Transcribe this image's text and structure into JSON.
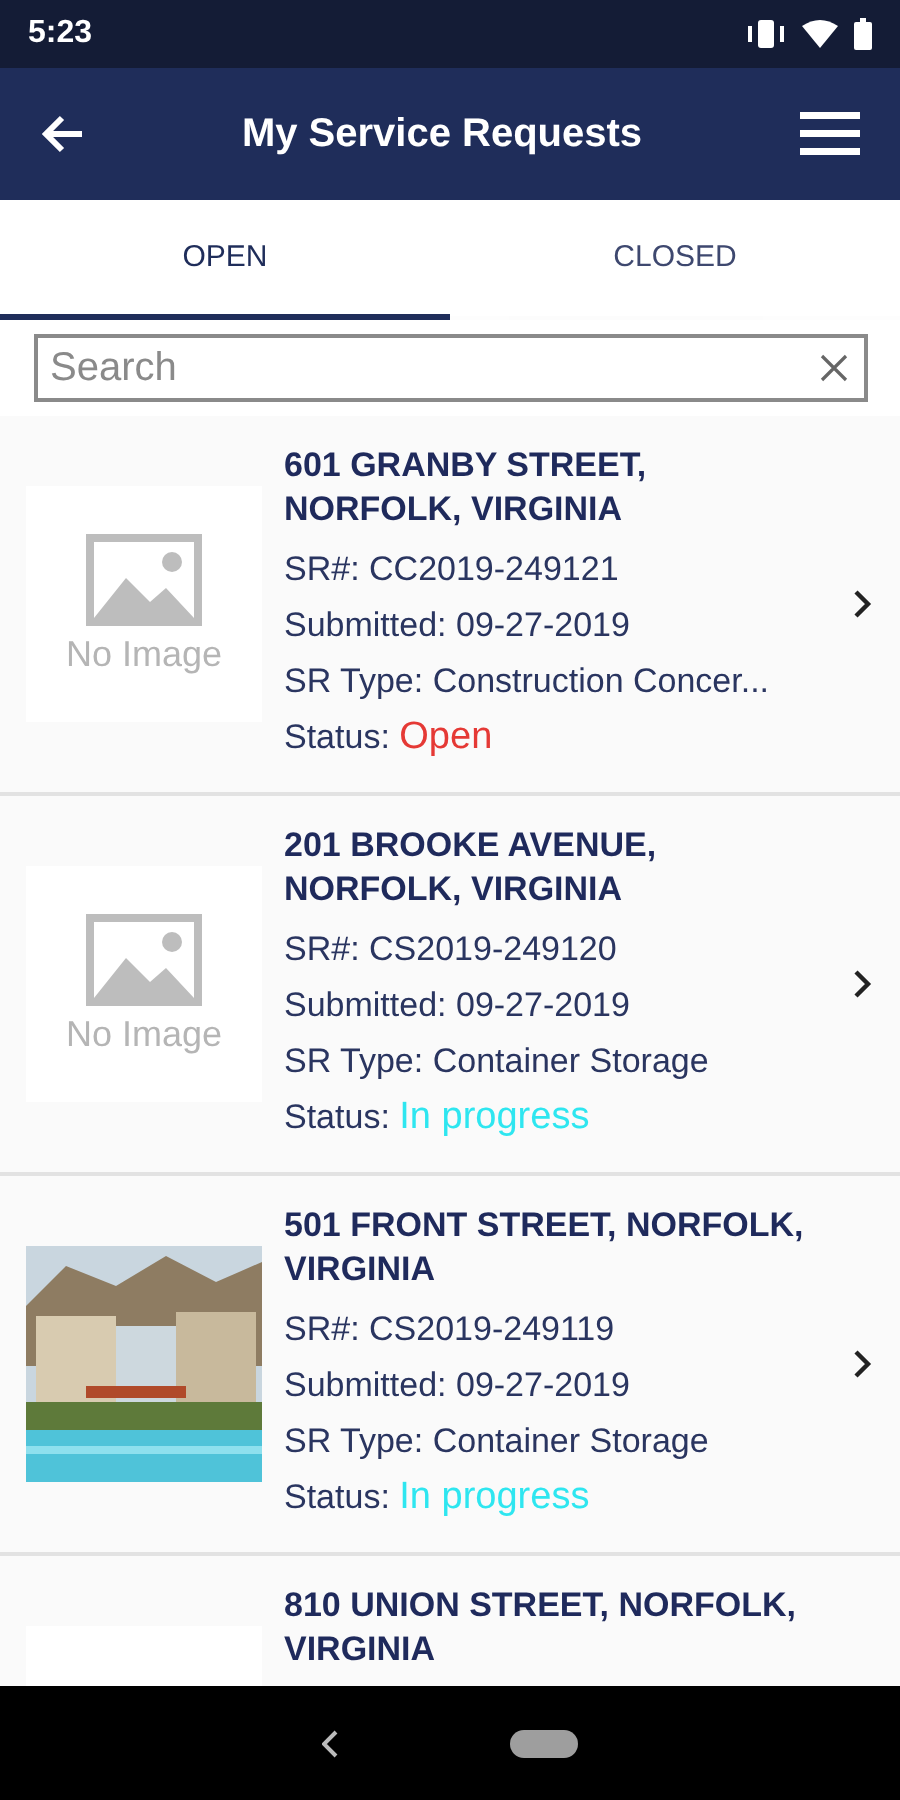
{
  "status_bar": {
    "time": "5:23"
  },
  "app_bar": {
    "title": "My Service Requests"
  },
  "tabs": [
    {
      "label": "OPEN",
      "selected": true
    },
    {
      "label": "CLOSED",
      "selected": false
    }
  ],
  "search": {
    "placeholder": "Search"
  },
  "requests": [
    {
      "address": "601 GRANBY STREET, NORFOLK, VIRGINIA",
      "image": {
        "kind": "placeholder",
        "label": "No Image"
      },
      "sr": "SR#: CC2019-249121",
      "submitted": "Submitted: 09-27-2019",
      "type": "SR Type: Construction Concer...",
      "status_label": "Status:",
      "status": "Open",
      "color": "#e53935"
    },
    {
      "address": "201 BROOKE AVENUE, NORFOLK, VIRGINIA",
      "image": {
        "kind": "placeholder",
        "label": "No Image"
      },
      "sr": "SR#: CS2019-249120",
      "submitted": "Submitted: 09-27-2019",
      "type": "SR Type: Container Storage",
      "status_label": "Status:",
      "status": "In progress",
      "color": "#2ee6f0"
    },
    {
      "address": "501 FRONT STREET, NORFOLK, VIRGINIA",
      "sr": "SR#: CS2019-249119",
      "submitted": "Submitted: 09-27-2019",
      "type": "SR Type: Container Storage",
      "status_label": "Status:",
      "status": "In progress",
      "color": "#2ee6f0"
    },
    {
      "address": "810 UNION STREET, NORFOLK, VIRGINIA",
      "image": {
        "kind": "blank"
      }
    }
  ]
}
